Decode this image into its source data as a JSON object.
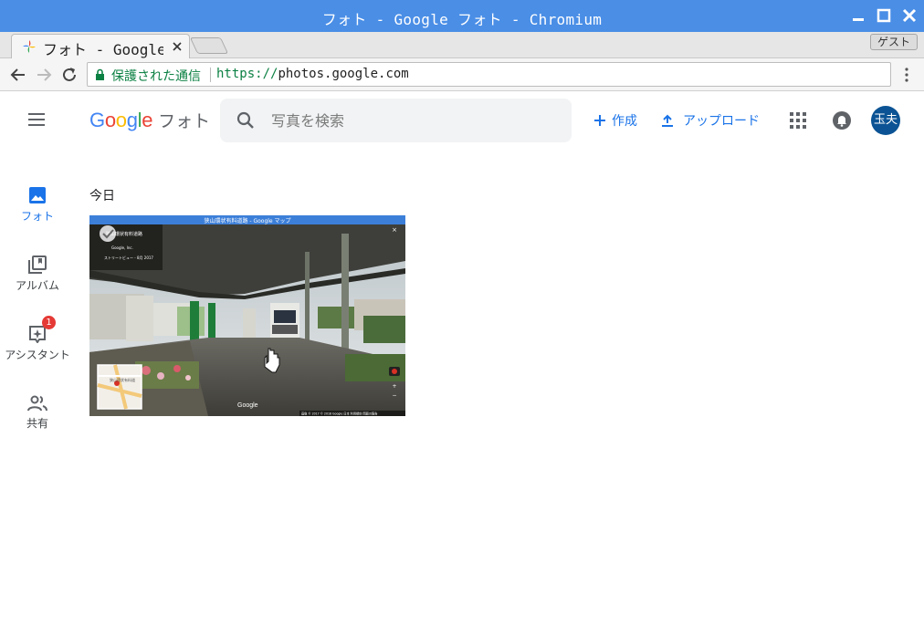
{
  "window": {
    "title": "フォト - Google フォト - Chromium"
  },
  "tab": {
    "title": "フォト - Google フォト"
  },
  "guest_label": "ゲスト",
  "omnibox": {
    "secure_label": "保護された通信",
    "scheme": "https://",
    "host": "photos.google.com"
  },
  "app": {
    "logo_word": "Google",
    "product": "フォト",
    "search_placeholder": "写真を検索",
    "create_label": "作成",
    "upload_label": "アップロード",
    "avatar_text": "玉夫"
  },
  "sidebar": {
    "items": [
      {
        "label": "フォト",
        "icon": "photo-icon",
        "active": true
      },
      {
        "label": "アルバム",
        "icon": "album-icon",
        "active": false
      },
      {
        "label": "アシスタント",
        "icon": "assistant-icon",
        "active": false,
        "badge": "1"
      },
      {
        "label": "共有",
        "icon": "people-icon",
        "active": false
      }
    ]
  },
  "content": {
    "section_title": "今日"
  },
  "thumbnail": {
    "window_title": "狭山環状有料道路 - Google マップ",
    "place_name": "狭山環状有料道路",
    "sublabel": "Google, Inc.",
    "date_label": "ストリートビュー - 8月 2017",
    "map_pin_label": "狭山環状有料道",
    "brand": "Google",
    "footer": "画像 © 2017  © 2018 Google  日本  利用規約  問題の報告"
  },
  "colors": {
    "titlebar": "#4a8ee6",
    "accent": "#1a73e8",
    "secure": "#0b8043",
    "avatar": "#0b5394",
    "badge": "#e53935"
  }
}
